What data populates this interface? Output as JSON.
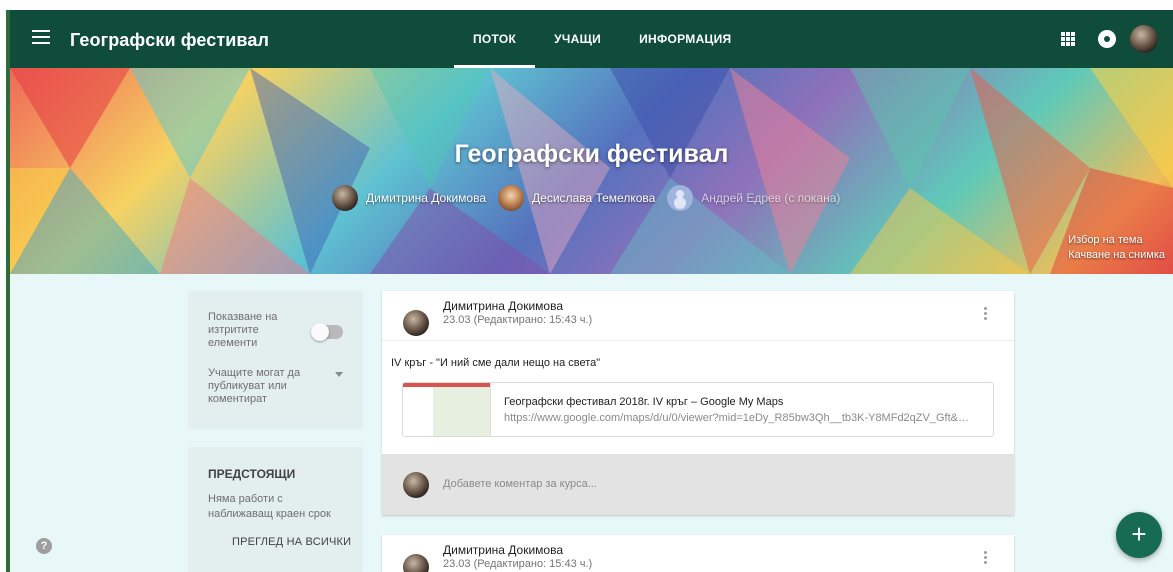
{
  "header": {
    "app_title": "Географски фестивал",
    "tabs": [
      {
        "label": "ПОТОК",
        "active": true
      },
      {
        "label": "УЧАЩИ",
        "active": false
      },
      {
        "label": "ИНФОРМАЦИЯ",
        "active": false
      }
    ],
    "icons": [
      "menu-icon",
      "apps-grid-icon",
      "notification-icon",
      "account-avatar"
    ],
    "bar_color": "#0f4d3a"
  },
  "banner": {
    "title": "Географски фестивал",
    "teachers": [
      {
        "name": "Димитрина Докимова",
        "invited": false
      },
      {
        "name": "Десислава Темелкова",
        "invited": false
      },
      {
        "name": "Андрей Едрев (с покана)",
        "invited": true
      }
    ],
    "select_theme": "Избор на тема",
    "upload_photo": "Качване на снимка"
  },
  "settings": {
    "show_deleted_label": "Показване на изтритите елементи",
    "show_deleted_on": false,
    "students_can_label": "Учащите могат да публикуват или коментират"
  },
  "upcoming": {
    "title": "ПРЕДСТОЯЩИ",
    "empty_text": "Няма работи с наближаващ краен срок",
    "view_all": "ПРЕГЛЕД НА ВСИЧКИ"
  },
  "posts": [
    {
      "author": "Димитрина Докимова",
      "time": "23.03 (Редактирано: 15:43 ч.)",
      "text": "IV кръг - \"И ний сме дали нещо на света\"",
      "attachment": {
        "title": "Географски фестивал 2018г. IV кръг – Google My Maps",
        "url": "https://www.google.com/maps/d/u/0/viewer?mid=1eDy_R85bw3Qh__tb3K-Y8MFd2qZV_Gft&vo..."
      },
      "comment_placeholder": "Добавете коментар за курса..."
    },
    {
      "author": "Димитрина Докимова",
      "time": "23.03 (Редактирано: 15:43 ч.)"
    }
  ],
  "fab_label": "+",
  "help_label": "?",
  "accent_color": "#166b52"
}
